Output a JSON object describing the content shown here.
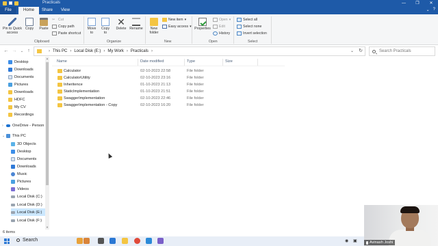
{
  "window": {
    "title": "Practicals",
    "controls": [
      "—",
      "❐",
      "✕"
    ]
  },
  "ribbon_tabs": [
    "File",
    "Home",
    "Share",
    "View"
  ],
  "ribbon": {
    "clipboard": {
      "pin": "Pin to Quick access",
      "copy": "Copy",
      "paste": "Paste",
      "cut": "Cut",
      "copy_path": "Copy path",
      "paste_shortcut": "Paste shortcut",
      "label": "Clipboard"
    },
    "organize": {
      "move_to": "Move to",
      "copy_to": "Copy to",
      "delete": "Delete",
      "rename": "Rename",
      "label": "Organize"
    },
    "new": {
      "new_folder": "New folder",
      "new_item": "New item",
      "easy_access": "Easy access",
      "label": "New"
    },
    "open": {
      "properties": "Properties",
      "open": "Open",
      "edit": "Edit",
      "history": "History",
      "label": "Open"
    },
    "select": {
      "select_all": "Select all",
      "select_none": "Select none",
      "invert": "Invert selection",
      "label": "Select"
    }
  },
  "address": {
    "crumbs": [
      "This PC",
      "Local Disk (E:)",
      "My Work",
      "Practicals"
    ],
    "search_placeholder": "Search Practicals"
  },
  "nav": {
    "items": [
      {
        "label": "Desktop",
        "icon": "desktop-icon",
        "pinned": true
      },
      {
        "label": "Downloads",
        "icon": "downloads-icon",
        "pinned": true
      },
      {
        "label": "Documents",
        "icon": "documents-icon",
        "pinned": true
      },
      {
        "label": "Pictures",
        "icon": "pictures-icon",
        "pinned": true
      },
      {
        "label": "Downloads",
        "icon": "folder-icon",
        "pinned": false
      },
      {
        "label": "HDFC",
        "icon": "folder-icon",
        "pinned": false
      },
      {
        "label": "My CV",
        "icon": "folder-icon",
        "pinned": false
      },
      {
        "label": "Recordings",
        "icon": "folder-icon",
        "pinned": false
      },
      {
        "label": "OneDrive - Person",
        "icon": "onedrive-icon",
        "pinned": false
      },
      {
        "label": "This PC",
        "icon": "this-pc-icon",
        "pinned": false
      },
      {
        "label": "3D Objects",
        "icon": "3d-objects-icon",
        "pinned": false
      },
      {
        "label": "Desktop",
        "icon": "desktop-icon",
        "pinned": false
      },
      {
        "label": "Documents",
        "icon": "documents-icon",
        "pinned": false
      },
      {
        "label": "Downloads",
        "icon": "downloads-icon",
        "pinned": false
      },
      {
        "label": "Music",
        "icon": "music-icon",
        "pinned": false
      },
      {
        "label": "Pictures",
        "icon": "pictures-icon",
        "pinned": false
      },
      {
        "label": "Videos",
        "icon": "videos-icon",
        "pinned": false
      },
      {
        "label": "Local Disk (C:)",
        "icon": "disk-icon",
        "pinned": false
      },
      {
        "label": "Local Disk (D:)",
        "icon": "disk-icon",
        "pinned": false
      },
      {
        "label": "Local Disk (E:)",
        "icon": "disk-icon",
        "pinned": false,
        "selected": true
      },
      {
        "label": "Local Disk (F:)",
        "icon": "disk-icon",
        "pinned": false
      }
    ]
  },
  "columns": [
    "Name",
    "Date modified",
    "Type",
    "Size"
  ],
  "files": [
    {
      "name": "Calculator",
      "date": "02-10-2023 22:58",
      "type": "File folder"
    },
    {
      "name": "CalculatorUtility",
      "date": "02-10-2023 23:16",
      "type": "File folder"
    },
    {
      "name": "Inheritence",
      "date": "01-10-2023 21:13",
      "type": "File folder"
    },
    {
      "name": "StaticImplementation",
      "date": "01-10-2023 21:51",
      "type": "File folder"
    },
    {
      "name": "SwaggerImplementation",
      "date": "02-10-2023 22:46",
      "type": "File folder"
    },
    {
      "name": "SwaggerImplementation - Copy",
      "date": "02-10-2023 16:20",
      "type": "File folder"
    }
  ],
  "status": {
    "item_count": "6 items"
  },
  "taskbar": {
    "search_label": "Search"
  },
  "webcam": {
    "name": "Avinash Joshi"
  },
  "colors": {
    "accent": "#1e5aa8",
    "folder": "#f4c542",
    "selection": "#cce8ff"
  }
}
